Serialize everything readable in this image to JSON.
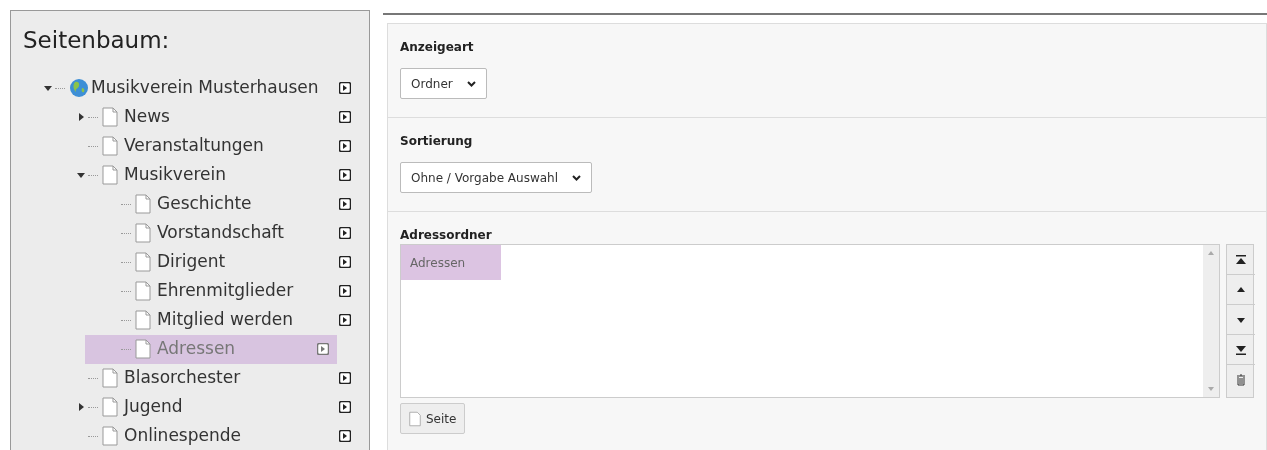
{
  "sidebar": {
    "title": "Seitenbaum:",
    "tree": [
      {
        "label": "Musikverein Musterhausen",
        "kind": "root",
        "expanded": true,
        "selected": false,
        "children": [
          {
            "label": "News",
            "kind": "page",
            "expanded": false,
            "selected": false
          },
          {
            "label": "Veranstaltungen",
            "kind": "page",
            "selected": false
          },
          {
            "label": "Musikverein",
            "kind": "page",
            "expanded": true,
            "selected": false,
            "children": [
              {
                "label": "Geschichte",
                "kind": "page",
                "selected": false
              },
              {
                "label": "Vorstandschaft",
                "kind": "page",
                "selected": false
              },
              {
                "label": "Dirigent",
                "kind": "page",
                "selected": false
              },
              {
                "label": "Ehrenmitglieder",
                "kind": "page",
                "selected": false
              },
              {
                "label": "Mitglied werden",
                "kind": "page",
                "selected": false
              },
              {
                "label": "Adressen",
                "kind": "page",
                "selected": true
              }
            ]
          },
          {
            "label": "Blasorchester",
            "kind": "page",
            "selected": false
          },
          {
            "label": "Jugend",
            "kind": "page",
            "expanded": false,
            "selected": false
          },
          {
            "label": "Onlinespende",
            "kind": "page",
            "selected": false
          }
        ]
      }
    ]
  },
  "form": {
    "sections": [
      {
        "label": "Anzeigeart",
        "kind": "select",
        "value": "Ordner"
      },
      {
        "label": "Sortierung",
        "kind": "select",
        "value": "Ohne / Vorgabe Auswahl"
      },
      {
        "label": "Adressordner",
        "kind": "list",
        "items": [
          {
            "label": "Adressen",
            "selected": true
          }
        ],
        "button": "Seite"
      }
    ]
  }
}
